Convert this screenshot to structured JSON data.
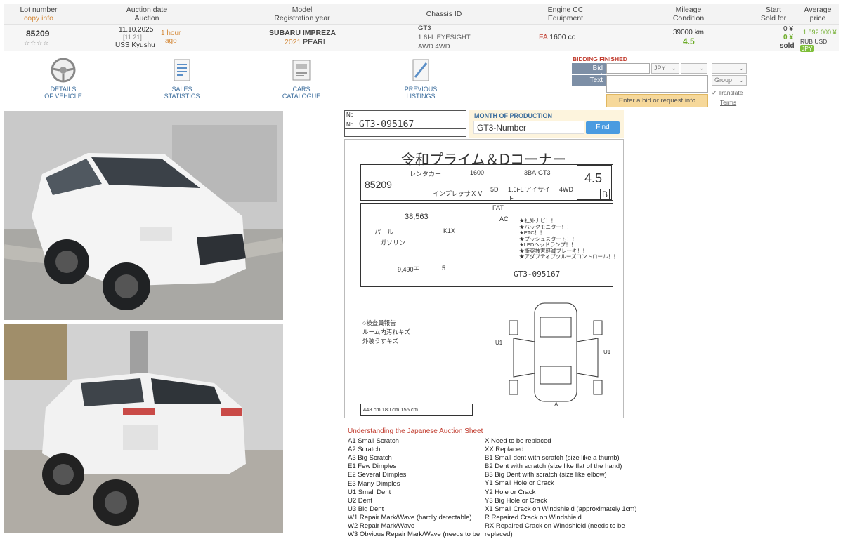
{
  "header": {
    "lot_number": "Lot number",
    "copy_info": "copy info",
    "auction_date": "Auction date",
    "auction": "Auction",
    "model": "Model",
    "registration_year": "Registration year",
    "chassis_id": "Chassis ID",
    "engine_cc": "Engine CC",
    "equipment": "Equipment",
    "mileage": "Mileage",
    "condition": "Condition",
    "start": "Start",
    "sold_for": "Sold for",
    "average": "Average",
    "price": "price"
  },
  "lot": {
    "number": "85209",
    "stars": "☆☆☆☆",
    "date": "11.10.2025",
    "time": "[11:21]",
    "ago": "1 hour",
    "ago2": "ago",
    "auction": "USS Kyushu",
    "model": "SUBARU IMPREZA",
    "year": "2021",
    "color": "PEARL",
    "chassis": "GT3",
    "spec1": "1.6I-L EYESIGHT",
    "spec2": "AWD 4WD",
    "engine_code": "FA",
    "engine_cc": "1600 cc",
    "mileage": "39000 km",
    "condition": "4.5",
    "start_price": "0 ¥",
    "sold_price": "0 ¥",
    "sold_label": "sold",
    "avg_price": "1 892 000 ¥",
    "cur_rub": "RUB",
    "cur_usd": "USD",
    "cur_jpy": "JPY"
  },
  "tools": [
    {
      "line1": "DETAILS",
      "line2": "OF VEHICLE",
      "icon": "steering-wheel-icon"
    },
    {
      "line1": "SALES",
      "line2": "STATISTICS",
      "icon": "document-icon"
    },
    {
      "line1": "CARS",
      "line2": "CATALOGUE",
      "icon": "catalogue-icon"
    },
    {
      "line1": "PREVIOUS",
      "line2": "LISTINGS",
      "icon": "listings-icon"
    }
  ],
  "bidding": {
    "status": "BIDDING FINISHED",
    "bid_request": "Bid request",
    "currency": "JPY",
    "text_label": "Text",
    "group": "Group",
    "submit": "Enter a bid or request info",
    "translate": "Translate",
    "terms": "Terms"
  },
  "chassis_box": {
    "no": "No",
    "chassis_value": "GT3-095167",
    "month_of_production": "MONTH OF PRODUCTION",
    "input_value": "GT3-Number",
    "find": "Find"
  },
  "sheet": {
    "title": "令和プライム＆Dコーナー",
    "lot": "85209",
    "grade": "4.5",
    "grade_interior": "B",
    "maker": "レンタカー",
    "cc": "1600",
    "model_code": "3BA-GT3",
    "car_name": "インプレッサＸＶ",
    "doors": "5D",
    "grade_name": "1.6i-L アイサイト",
    "drive": "4WD",
    "mileage": "38,563",
    "shift": "FAT",
    "ac": "AC",
    "color": "パール",
    "color_code": "K1X",
    "fuel": "ガソリン",
    "recycle": "9,490円",
    "seats": "5",
    "chassis": "GT3-095167",
    "sales_points": [
      "★社外ナビ！！",
      "★バックモニター！！",
      "★ETC！！",
      "★プッシュスタート！！",
      "★LEDヘッドランプ！！",
      "★衝突被害軽減ブレーキ！！",
      "★アダプティブクルーズコントロール！！"
    ],
    "inspector_notes": [
      "○検査員報告",
      "ルーム内汚れキズ",
      "外装うすキズ"
    ],
    "damage_marks": [
      "U1",
      "U1",
      "A"
    ],
    "dims": "448 cm  180 cm  155 cm"
  },
  "legend": {
    "title": "Understanding the Japanese Auction Sheet",
    "left": [
      "A1 Small Scratch",
      "A2 Scratch",
      "A3 Big Scratch",
      "E1 Few Dimples",
      "E2 Several Dimples",
      "E3 Many Dimples",
      "U1 Small Dent",
      "U2 Dent",
      "U3 Big Dent",
      "W1 Repair Mark/Wave (hardly detectable)",
      "W2 Repair Mark/Wave",
      "W3 Obvious Repair Mark/Wave (needs to be"
    ],
    "right": [
      "X Need to be replaced",
      "XX Replaced",
      "B1 Small dent with scratch (size like a thumb)",
      "B2 Dent with scratch (size like flat of the hand)",
      "B3 Big Dent with scratch (size like elbow)",
      "Y1 Small Hole or Crack",
      "Y2 Hole or Crack",
      "Y3 Big Hole or Crack",
      "X1 Small Crack on Windshield (approximately 1cm)",
      "R Repaired Crack on Windshield",
      "RX Repaired Crack on Windshield (needs to be",
      "replaced)"
    ]
  }
}
